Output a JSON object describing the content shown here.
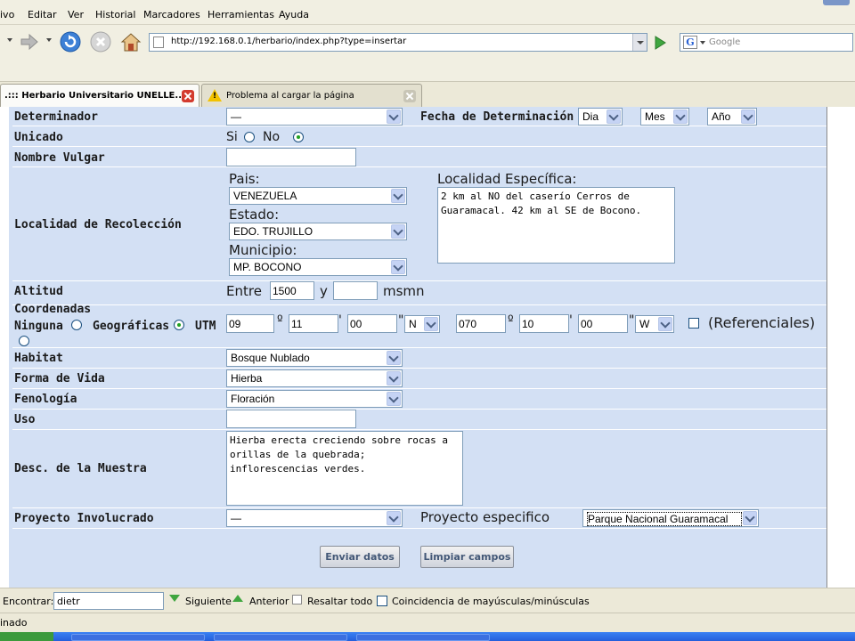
{
  "menu": [
    "ivo",
    "Editar",
    "Ver",
    "Historial",
    "Marcadores",
    "Herramientas",
    "Ayuda"
  ],
  "url": "http://192.168.0.1/herbario/index.php?type=insertar",
  "search_placeholder": "Google",
  "tabs": [
    {
      "label": ".::: Herbario Universitario UNELLE..."
    },
    {
      "label": "Problema al cargar la página"
    }
  ],
  "form": {
    "determinador": {
      "label": "Determinador",
      "value": "—"
    },
    "fecha": {
      "label": "Fecha de Determinación",
      "dia": "Dia",
      "mes": "Mes",
      "anio": "Año"
    },
    "unicado": {
      "label": "Unicado",
      "si": "Si",
      "no": "No",
      "selected": "No"
    },
    "nombre_vulgar": {
      "label": "Nombre Vulgar",
      "value": ""
    },
    "localidad": {
      "label": "Localidad de Recolección",
      "pais_label": "Pais:",
      "pais": "VENEZUELA",
      "estado_label": "Estado:",
      "estado": "EDO. TRUJILLO",
      "municipio_label": "Municipio:",
      "municipio": "MP. BOCONO",
      "especifica_label": "Localidad Específica:",
      "especifica": "2 km al NO del caserío Cerros de Guaramacal. 42 km al SE de Bocono."
    },
    "altitud": {
      "label": "Altitud",
      "entre": "Entre",
      "desde": "1500",
      "y": "y",
      "hasta": "",
      "unidad": "msmn"
    },
    "coordenadas": {
      "label": "Coordenadas",
      "opciones": [
        "Ninguna",
        "Geográficas",
        "UTM"
      ],
      "selected": "Geográficas",
      "lat": {
        "grados": "09",
        "minutos": "11",
        "segundos": "00",
        "hemisferio": "N"
      },
      "lon": {
        "grados": "070",
        "minutos": "10",
        "segundos": "00",
        "hemisferio": "W"
      },
      "deg_symbol": "º",
      "min_symbol": "'",
      "sec_symbol": "\"",
      "referenciales": "(Referenciales)"
    },
    "habitat": {
      "label": "Habitat",
      "value": "Bosque Nublado"
    },
    "forma_vida": {
      "label": "Forma de Vida",
      "value": "Hierba"
    },
    "fenologia": {
      "label": "Fenología",
      "value": "Floración"
    },
    "uso": {
      "label": "Uso",
      "value": ""
    },
    "descripcion": {
      "label": "Desc. de la Muestra",
      "value": "Hierba erecta creciendo sobre rocas a orillas de la quebrada; inflorescencias verdes."
    },
    "proyecto": {
      "label": "Proyecto Involucrado",
      "value": "—",
      "especifico_label": "Proyecto especifico",
      "especifico": "Parque Nacional Guaramacal"
    },
    "enviar": "Enviar datos",
    "limpiar": "Limpiar campos"
  },
  "findbar": {
    "label": "Encontrar:",
    "value": "dietr",
    "next": "Siguiente",
    "prev": "Anterior",
    "highlight": "Resaltar todo",
    "match_case": "Coincidencia de mayúsculas/minúsculas"
  },
  "status": "inado"
}
